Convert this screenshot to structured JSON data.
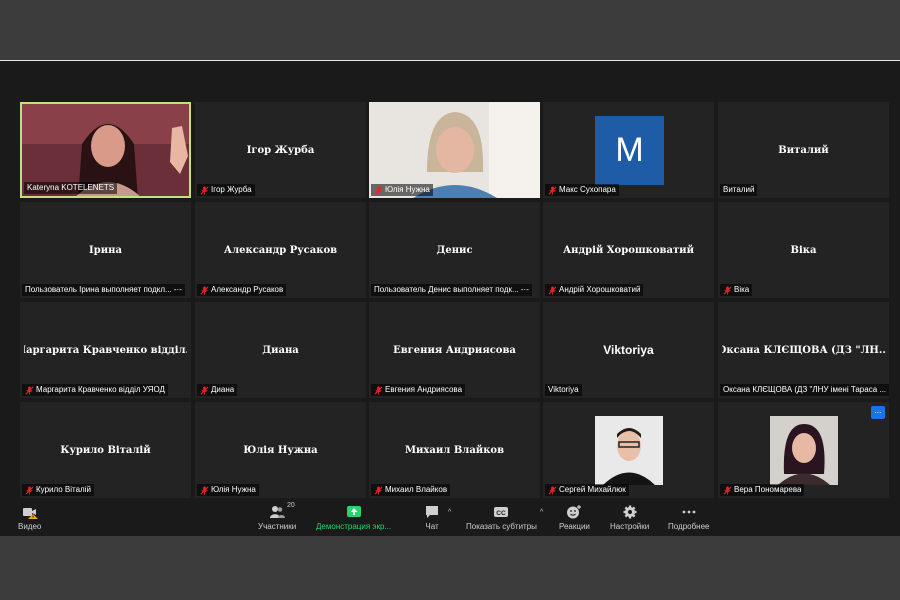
{
  "tiles": [
    {
      "caption": "Kateryna KOTELENETS",
      "name": "",
      "muted": false,
      "type": "video-speaker",
      "active": true
    },
    {
      "caption": "Ігор Журба",
      "name": "Ігор Журба",
      "muted": true,
      "type": "name"
    },
    {
      "caption": "Юлія Нужна",
      "name": "",
      "muted": true,
      "type": "video-woman"
    },
    {
      "caption": "Макс Сухопара",
      "name": "",
      "muted": true,
      "type": "avatar",
      "avatar_letter": "M"
    },
    {
      "caption": "Виталий",
      "name": "Виталий",
      "muted": false,
      "type": "name"
    },
    {
      "caption": "Пользователь Ірина выполняет подкл... -·-",
      "name": "Ірина",
      "muted": false,
      "type": "name"
    },
    {
      "caption": "Александр Русаков",
      "name": "Александр Русаков",
      "muted": true,
      "type": "name"
    },
    {
      "caption": "Пользователь Денис выполняет подк... -·-",
      "name": "Денис",
      "muted": false,
      "type": "name"
    },
    {
      "caption": "Андрій Хорошковатий",
      "name": "Андрій Хорошковатий",
      "muted": true,
      "type": "name"
    },
    {
      "caption": "Віка",
      "name": "Віка",
      "muted": true,
      "type": "name"
    },
    {
      "caption": "Маргарита Кравченко відділ УЯОД",
      "name": "Маргарита Кравченко відділ...",
      "muted": true,
      "type": "name"
    },
    {
      "caption": "Диана",
      "name": "Диана",
      "muted": true,
      "type": "name"
    },
    {
      "caption": "Евгения Андриясова",
      "name": "Евгения Андриясова",
      "muted": true,
      "type": "name"
    },
    {
      "caption": "Viktoriya",
      "name": "Viktoriya",
      "muted": false,
      "type": "name-sans"
    },
    {
      "caption": "Оксана КЛЄЩОВА (ДЗ \"ЛНУ імені Тараса ...",
      "name": "Оксана КЛЄЩОВА (ДЗ \"ЛН...",
      "muted": false,
      "type": "name"
    },
    {
      "caption": "Курило Віталій",
      "name": "Курило Віталій",
      "muted": true,
      "type": "name"
    },
    {
      "caption": "Юлія Нужна",
      "name": "Юлія Нужна",
      "muted": true,
      "type": "name"
    },
    {
      "caption": "Михаил Влайков",
      "name": "Михаил Влайков",
      "muted": true,
      "type": "name"
    },
    {
      "caption": "Сергей Михайлюк",
      "name": "",
      "muted": true,
      "type": "profile-boy"
    },
    {
      "caption": "Вера Пономарева",
      "name": "",
      "muted": true,
      "type": "profile-woman",
      "badge": "..."
    }
  ],
  "toolbar": {
    "video_label": "Видео",
    "participants_label": "Участники",
    "participants_count": "20",
    "share_label": "Демонстрация экр...",
    "chat_label": "Чат",
    "captions_label": "Показать субтитры",
    "reactions_label": "Реакции",
    "settings_label": "Настройки",
    "more_label": "Подробнее"
  },
  "colors": {
    "active_border": "#c3e07e",
    "share_green": "#2bd36b",
    "avatar_blue": "#1e5ca8",
    "muted_red": "#e02828"
  }
}
